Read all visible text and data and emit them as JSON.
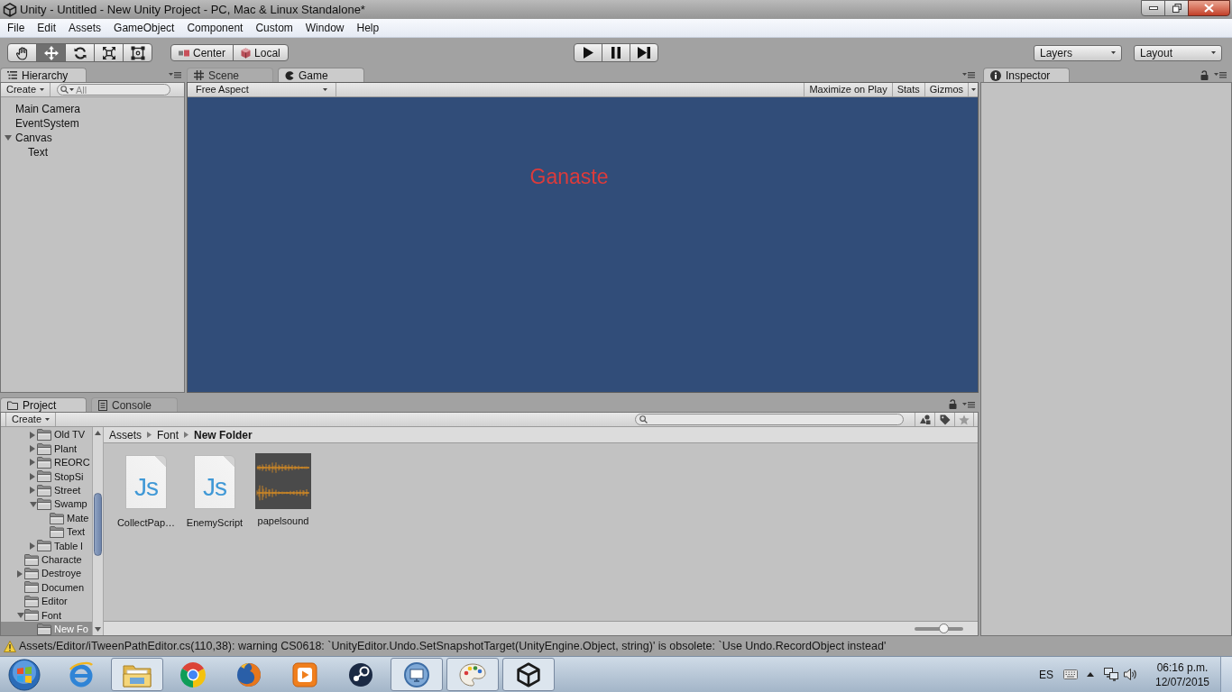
{
  "window": {
    "title": "Unity - Untitled - New Unity Project - PC, Mac & Linux Standalone*"
  },
  "menu": [
    "File",
    "Edit",
    "Assets",
    "GameObject",
    "Component",
    "Custom",
    "Window",
    "Help"
  ],
  "toolbar": {
    "tools": [
      {
        "kind": "hand",
        "selected": false
      },
      {
        "kind": "move",
        "selected": true
      },
      {
        "kind": "rotate",
        "selected": false
      },
      {
        "kind": "scale",
        "selected": false
      },
      {
        "kind": "rect",
        "selected": false
      }
    ],
    "pivot": [
      {
        "kind": "center",
        "label": "Center"
      },
      {
        "kind": "local",
        "label": "Local"
      }
    ],
    "playback": [
      {
        "kind": "play"
      },
      {
        "kind": "pause"
      },
      {
        "kind": "step"
      }
    ],
    "dropdowns": [
      "Layers",
      "Layout"
    ]
  },
  "hierarchy": {
    "tab": {
      "label": "Hierarchy",
      "selected": true
    },
    "create": "Create",
    "search": {
      "placeholder": "All"
    },
    "items": [
      {
        "label": "Main Camera",
        "selected": false
      },
      {
        "label": "EventSystem",
        "selected": false
      },
      {
        "label": "Canvas",
        "selected": false,
        "expanded": true,
        "children": [
          {
            "label": "Text",
            "selected": false
          }
        ]
      }
    ]
  },
  "view_tabs": [
    {
      "kind": "scene",
      "label": "Scene",
      "selected": false
    },
    {
      "kind": "game",
      "label": "Game",
      "selected": true
    }
  ],
  "game": {
    "aspect": "Free Aspect",
    "toggles": [
      {
        "kind": "toggle",
        "label": "Maximize on Play",
        "on": false
      },
      {
        "kind": "toggle",
        "label": "Stats",
        "on": false
      },
      {
        "kind": "dropdown",
        "label": "Gizmos",
        "on": false
      }
    ],
    "canvas_text": "Ganaste"
  },
  "inspector": {
    "tab": {
      "label": "Inspector",
      "selected": true
    }
  },
  "bottom_tabs": [
    {
      "kind": "project",
      "label": "Project",
      "selected": true
    },
    {
      "kind": "console",
      "label": "Console",
      "selected": false
    }
  ],
  "project": {
    "create": "Create",
    "folders": {
      "continued": [
        {
          "label": "Old TV",
          "expanded": false,
          "selected": false
        },
        {
          "label": "Plant",
          "expanded": false,
          "selected": false
        },
        {
          "label": "REORC",
          "expanded": false,
          "selected": false
        },
        {
          "label": "StopSi",
          "expanded": false,
          "selected": false
        },
        {
          "label": "Street",
          "expanded": false,
          "selected": false
        },
        {
          "label": "Swamp",
          "expanded": true,
          "selected": false,
          "children": [
            {
              "label": "Mate",
              "selected": false
            },
            {
              "label": "Text",
              "selected": false
            }
          ]
        },
        {
          "label": "Table l",
          "expanded": false,
          "selected": false
        }
      ],
      "items": [
        {
          "label": "Characte",
          "selected": false
        },
        {
          "label": "Destroye",
          "expanded": false,
          "selected": false
        },
        {
          "label": "Documen",
          "selected": false
        },
        {
          "label": "Editor",
          "selected": false
        },
        {
          "label": "Font",
          "expanded": true,
          "selected": false,
          "children": [
            {
              "label": "New Fo",
              "selected": true
            }
          ]
        }
      ]
    },
    "breadcrumb": [
      "Assets",
      "Font",
      "New Folder"
    ],
    "assets": [
      {
        "kind": "script",
        "name": "CollectPap…",
        "icon_label": "Js"
      },
      {
        "kind": "script",
        "name": "EnemyScript",
        "icon_label": "Js"
      },
      {
        "kind": "audio",
        "name": "papelsound"
      }
    ],
    "zoom": {
      "level": 0.6
    }
  },
  "status": {
    "kind": "warning",
    "message": "Assets/Editor/iTweenPathEditor.cs(110,38): warning CS0618: `UnityEditor.Undo.SetSnapshotTarget(UnityEngine.Object, string)' is obsolete: `Use Undo.RecordObject instead'"
  },
  "taskbar": {
    "apps": [
      {
        "kind": "ie",
        "running": false
      },
      {
        "kind": "explorer",
        "running": true
      },
      {
        "kind": "chrome",
        "running": false
      },
      {
        "kind": "firefox",
        "running": false
      },
      {
        "kind": "media",
        "running": false
      },
      {
        "kind": "steam",
        "running": false
      },
      {
        "kind": "remote",
        "running": true
      },
      {
        "kind": "paint",
        "running": true
      },
      {
        "kind": "unity",
        "running": true
      }
    ],
    "language": "ES",
    "time": "06:16 p.m.",
    "date": "12/07/2015"
  }
}
